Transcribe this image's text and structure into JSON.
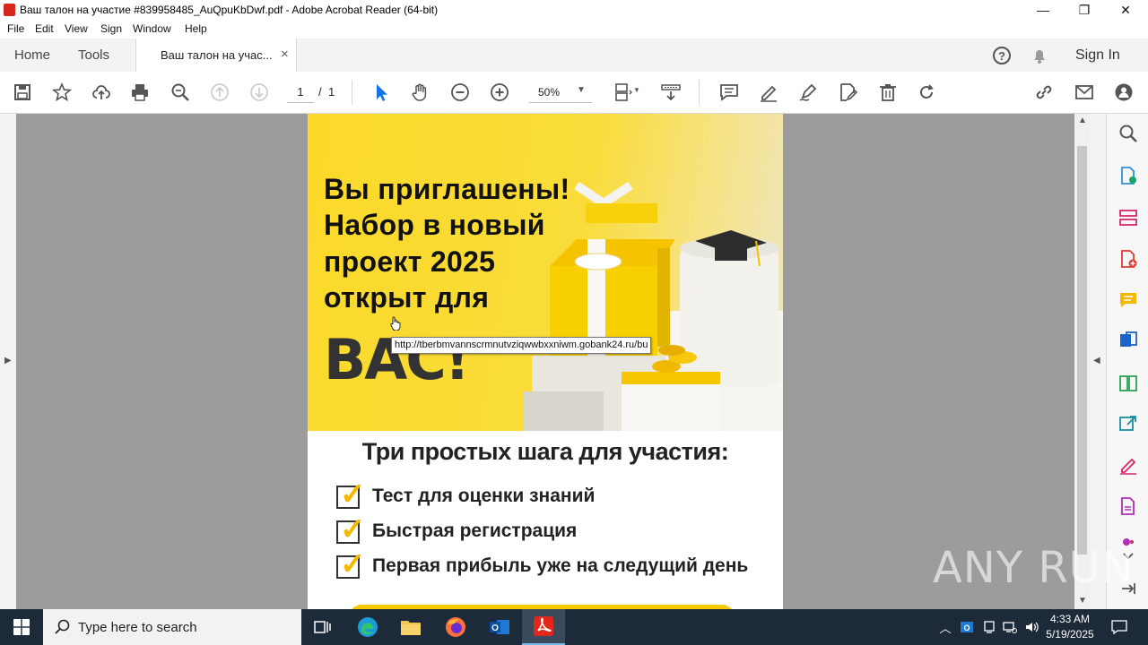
{
  "window": {
    "title": "Ваш талон на участие #839958485_AuQpuKbDwf.pdf - Adobe Acrobat Reader (64-bit)",
    "minimize": "—",
    "maximize": "❐",
    "close": "✕"
  },
  "menu": [
    "File",
    "Edit",
    "View",
    "Sign",
    "Window",
    "Help"
  ],
  "tabs": {
    "home": "Home",
    "tools": "Tools",
    "document": "Ваш талон на учас...",
    "close": "×",
    "sign_in": "Sign In"
  },
  "toolbar": {
    "page_current": "1",
    "page_separator": "/",
    "page_total": "1",
    "zoom": "50%"
  },
  "document": {
    "headline": [
      "Вы приглашены!",
      "Набор в новый",
      "проект 2025",
      "открыт для"
    ],
    "big_word": "ВАС!",
    "steps_title": "Три простых шага для участия:",
    "steps": [
      "Тест для оценки знаний",
      "Быстрая регистрация",
      "Первая прибыль уже на следущий день"
    ]
  },
  "tooltip": {
    "url": "http://tberbmvannscrmnutvziqwwbxxniwm.gobank24.ru/bu"
  },
  "watermark": "ANY RUN",
  "taskbar": {
    "search_placeholder": "Type here to search",
    "time": "4:33 AM",
    "date": "5/19/2025"
  },
  "colors": {
    "banner_yellow": "#fbd928",
    "acrobat_red": "#d7261c",
    "select_blue": "#1473e6",
    "taskbar": "#1c2a3a"
  }
}
